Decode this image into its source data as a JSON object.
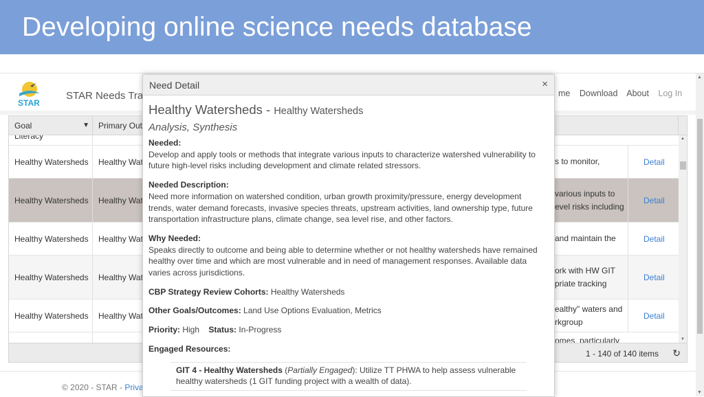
{
  "slide": {
    "title": "Developing online science needs database"
  },
  "site": {
    "logo_text": "STAR",
    "brand": "STAR Needs Trac",
    "nav": [
      "me",
      "Download",
      "About",
      "Log In"
    ]
  },
  "grid": {
    "columns": [
      "Goal",
      "Primary Out"
    ],
    "partial_row": {
      "goal": "Literacy"
    },
    "rows": [
      {
        "goal": "Healthy Watersheds",
        "outcome": "Healthy Wat",
        "desc": "s to monitor,",
        "detail": "Detail"
      },
      {
        "goal": "Healthy Watersheds",
        "outcome": "Healthy Wat",
        "desc": "various inputs to\nevel risks including",
        "detail": "Detail",
        "selected": true
      },
      {
        "goal": "Healthy Watersheds",
        "outcome": "Healthy Wat",
        "desc": "and maintain the",
        "detail": "Detail"
      },
      {
        "goal": "Healthy Watersheds",
        "outcome": "Healthy Wat",
        "desc": "ork with HW GIT\npriate tracking",
        "detail": "Detail"
      },
      {
        "goal": "Healthy Watersheds",
        "outcome": "Healthy Wat",
        "desc": "ealthy\" waters and\nrkgroup",
        "detail": "Detail"
      }
    ],
    "partial_bottom": "omes, particularly",
    "pager": "1 - 140 of 140 items"
  },
  "footer": {
    "text": "© 2020 - STAR - ",
    "link": "Priva"
  },
  "modal": {
    "title": "Need Detail",
    "heading": "Healthy Watersheds - ",
    "heading_sub": "Healthy Watersheds",
    "type": "Analysis, Synthesis",
    "needed_label": "Needed:",
    "needed": "Develop and apply tools or methods that integrate various inputs to characterize watershed vulnerability to future high-level risks including development and climate related stressors.",
    "desc_label": "Needed Description:",
    "desc": "Need more information on watershed condition, urban growth proximity/pressure, energy development trends, water demand forecasts, invasive species threats, upstream activities, land ownership type, future transportation infrastructure plans, climate change, sea level rise, and other factors.",
    "why_label": "Why Needed:",
    "why": "Speaks directly to outcome and being able to determine whether or not healthy watersheds have remained healthy over time and which are most vulnerable and in need of management responses. Available data varies across jurisdictions.",
    "cohorts_label": "CBP Strategy Review Cohorts:",
    "cohorts": " Healthy Watersheds",
    "other_label": "Other Goals/Outcomes:",
    "other": " Land Use Options Evaluation, Metrics",
    "priority_label": "Priority:",
    "priority": " High",
    "status_label": "Status:",
    "status": " In-Progress",
    "engaged_label": "Engaged Resources:",
    "resource": {
      "name": "GIT 4 - Healthy Watersheds",
      "state": "Partially Engaged",
      "text": ": Utilize TT PHWA to help assess vulnerable healthy watersheds (1 GIT funding project with a wealth of data)."
    }
  },
  "colors": {
    "title_bar": "#7b9fd8",
    "link": "#3b7fd0",
    "selected_row": "#cac3bf"
  }
}
